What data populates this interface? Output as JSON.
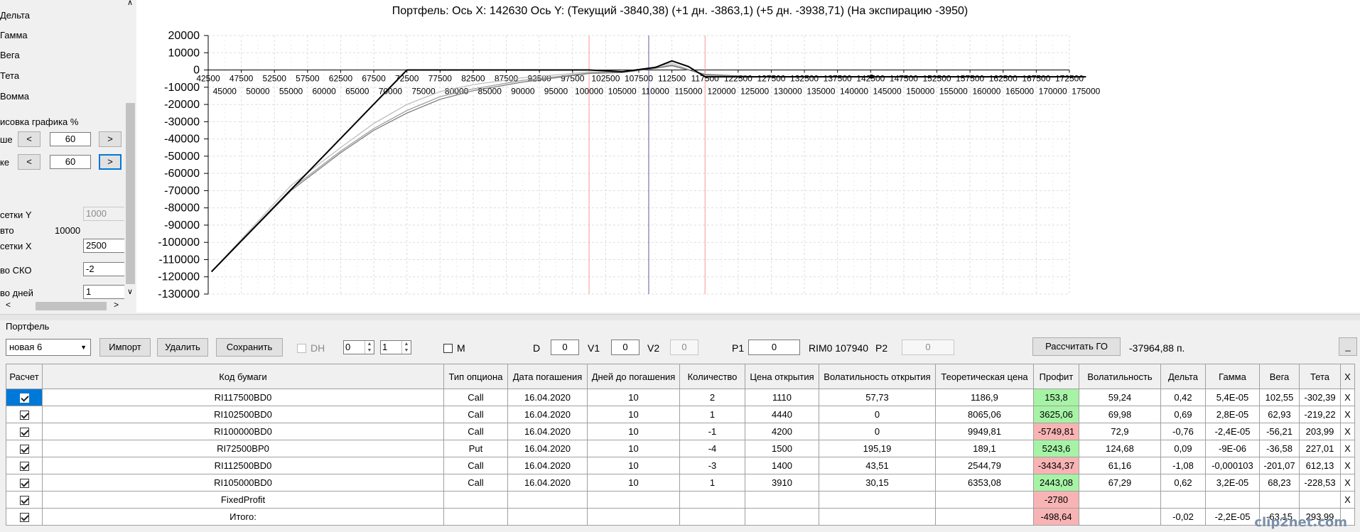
{
  "left_panel": {
    "greeks": [
      "Дельта",
      "Гамма",
      "Вега",
      "Тета",
      "Вомма"
    ],
    "render_label": "исовка графика %",
    "row1_label": "ше",
    "row1_value": "60",
    "row2_label": "ке",
    "row2_value": "60",
    "btn_dec": "<",
    "btn_inc": ">",
    "grid_y_label": "сетки Y",
    "grid_y_value": "1000",
    "auto_label": "вто",
    "auto_value": "10000",
    "grid_x_label": "сетки X",
    "grid_x_value": "2500",
    "sko_label": "во СКО",
    "sko_value": "-2",
    "days_label": "во дней",
    "days_value": "1",
    "scroll_left": "<",
    "scroll_right": ">",
    "scroll_down": "∨",
    "scroll_up": "∧"
  },
  "chart_title": "Портфель: Ось X: 142630 Ось Y:  (Текущий -3840,38)  (+1 дн. -3863,1)  (+5 дн. -3938,71)  (На экспирацию -3950)",
  "chart_data": {
    "type": "line",
    "title": "Портфель: Ось X: 142630 Ось Y:  (Текущий -3840,38)  (+1 дн. -3863,1)  (+5 дн. -3938,71)  (На экспирацию -3950)",
    "xlim": [
      42500,
      175000
    ],
    "ylim": [
      -130000,
      20000
    ],
    "x_ticks_upper": [
      "42500",
      "47500",
      "52500",
      "57500",
      "62500",
      "67500",
      "72500",
      "77500",
      "82500",
      "87500",
      "92500",
      "97500",
      "102500",
      "107500",
      "112500",
      "117500",
      "122500",
      "127500",
      "132500",
      "137500",
      "142500",
      "147500",
      "152500",
      "157500",
      "162500",
      "167500",
      "172500"
    ],
    "x_ticks_lower": [
      "45000",
      "50000",
      "55000",
      "60000",
      "65000",
      "70000",
      "75000",
      "80000",
      "85000",
      "90000",
      "95000",
      "100000",
      "105000",
      "110000",
      "115000",
      "120000",
      "125000",
      "130000",
      "135000",
      "140000",
      "145000",
      "150000",
      "155000",
      "160000",
      "165000",
      "170000",
      "175000"
    ],
    "y_ticks": [
      "20000",
      "10000",
      "0",
      "-10000",
      "-20000",
      "-30000",
      "-40000",
      "-50000",
      "-60000",
      "-70000",
      "-80000",
      "-90000",
      "-100000",
      "-110000",
      "-120000",
      "-130000"
    ],
    "grid": true,
    "vlines": [
      {
        "x": 100000,
        "color": "#ff9999"
      },
      {
        "x": 109000,
        "color": "#5a5aa0"
      },
      {
        "x": 117500,
        "color": "#ff9999"
      }
    ],
    "series": [
      {
        "style": "expiration",
        "color": "#000000",
        "x": [
          43000,
          72500,
          100000,
          105000,
          110000,
          112500,
          115000,
          117500,
          175000
        ],
        "y": [
          -117000,
          0,
          0,
          -1000,
          1500,
          5300,
          2000,
          -3950,
          -3950
        ]
      },
      {
        "style": "current",
        "color": "#777777",
        "x": [
          43000,
          55000,
          62500,
          67500,
          72500,
          77500,
          82500,
          90000,
          100000,
          105000,
          110000,
          112500,
          117500,
          125000,
          175000
        ],
        "y": [
          -117000,
          -70000,
          -48000,
          -35000,
          -25000,
          -17000,
          -12000,
          -7000,
          -2000,
          -1500,
          1000,
          2500,
          -2500,
          -3800,
          -3840
        ]
      },
      {
        "style": "plus1",
        "color": "#999999",
        "x": [
          43000,
          55000,
          62500,
          67500,
          72500,
          77500,
          82500,
          90000,
          100000,
          105000,
          110000,
          112500,
          117500,
          125000,
          175000
        ],
        "y": [
          -117000,
          -69000,
          -47000,
          -34000,
          -23500,
          -15500,
          -11000,
          -6000,
          -1800,
          -1400,
          1200,
          3000,
          -2800,
          -3850,
          -3863
        ]
      },
      {
        "style": "plus5",
        "color": "#bbbbbb",
        "x": [
          43000,
          55000,
          62500,
          67500,
          72500,
          77500,
          82500,
          90000,
          100000,
          105000,
          110000,
          112500,
          117500,
          125000,
          175000
        ],
        "y": [
          -117000,
          -67000,
          -45000,
          -31000,
          -20000,
          -12500,
          -8500,
          -4500,
          -1200,
          -1200,
          1800,
          4000,
          -3300,
          -3930,
          -3938
        ]
      }
    ],
    "marker": {
      "x": 142630,
      "y": -3840
    }
  },
  "portfolio": {
    "section_label": "Портфель",
    "combo_value": "новая 6",
    "btn_import": "Импорт",
    "btn_delete": "Удалить",
    "btn_save": "Сохранить",
    "dh_label": "DH",
    "spin1": "0",
    "spin2": "1",
    "m_label": "M",
    "d_label": "D",
    "d_value": "0",
    "v1_label": "V1",
    "v1_value": "0",
    "v2_label": "V2",
    "v2_value": "0",
    "p1_label": "P1",
    "p1_value": "0",
    "rim_label": "RIM0 107940",
    "p2_label": "P2",
    "p2_value": "0",
    "btn_go": "Рассчитать ГО",
    "go_value": "-37964,88 п.",
    "btn_min": "_"
  },
  "table": {
    "headers": [
      "Расчет",
      "Код бумаги",
      "Тип опциона",
      "Дата погашения",
      "Дней до погашения",
      "Количество",
      "Цена открытия",
      "Волатильность открытия",
      "Теоретическая цена",
      "Профит",
      "Волатильность",
      "Дельта",
      "Гамма",
      "Вега",
      "Тета",
      "X"
    ],
    "rows": [
      [
        "RI117500BD0",
        "Call",
        "16.04.2020",
        "10",
        "2",
        "1110",
        "57,73",
        "1186,9",
        "153,8",
        "59,24",
        "0,42",
        "5,4E-05",
        "102,55",
        "-302,39",
        "X"
      ],
      [
        "RI102500BD0",
        "Call",
        "16.04.2020",
        "10",
        "1",
        "4440",
        "0",
        "8065,06",
        "3625,06",
        "69,98",
        "0,69",
        "2,8E-05",
        "62,93",
        "-219,22",
        "X"
      ],
      [
        "RI100000BD0",
        "Call",
        "16.04.2020",
        "10",
        "-1",
        "4200",
        "0",
        "9949,81",
        "-5749,81",
        "72,9",
        "-0,76",
        "-2,4E-05",
        "-56,21",
        "203,99",
        "X"
      ],
      [
        "RI72500BP0",
        "Put",
        "16.04.2020",
        "10",
        "-4",
        "1500",
        "195,19",
        "189,1",
        "5243,6",
        "124,68",
        "0,09",
        "-9E-06",
        "-36,58",
        "227,01",
        "X"
      ],
      [
        "RI112500BD0",
        "Call",
        "16.04.2020",
        "10",
        "-3",
        "1400",
        "43,51",
        "2544,79",
        "-3434,37",
        "61,16",
        "-1,08",
        "-0,000103",
        "-201,07",
        "612,13",
        "X"
      ],
      [
        "RI105000BD0",
        "Call",
        "16.04.2020",
        "10",
        "1",
        "3910",
        "30,15",
        "6353,08",
        "2443,08",
        "67,29",
        "0,62",
        "3,2E-05",
        "68,23",
        "-228,53",
        "X"
      ],
      [
        "FixedProfit",
        "",
        "",
        "",
        "",
        "",
        "",
        "",
        "-2780",
        "",
        "",
        "",
        "",
        "",
        "X"
      ],
      [
        "Итого:",
        "",
        "",
        "",
        "",
        "",
        "",
        "",
        "-498,64",
        "",
        "-0,02",
        "-2,2E-05",
        "-63,15",
        "293,99",
        ""
      ]
    ],
    "profit_status": [
      "pos",
      "pos",
      "neg",
      "pos",
      "neg",
      "pos",
      "neg",
      "neg"
    ]
  },
  "watermark": "clip2net.com"
}
